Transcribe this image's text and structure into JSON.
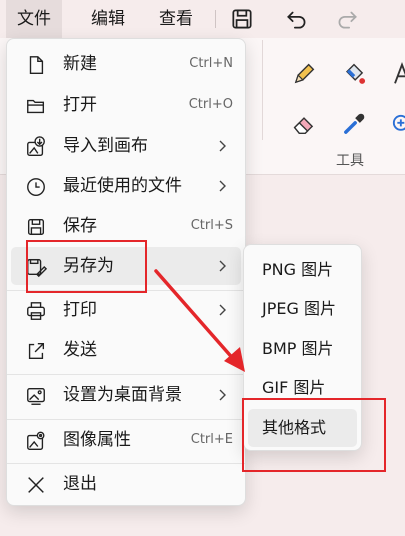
{
  "menubar": {
    "file": "文件",
    "edit": "编辑",
    "view": "查看",
    "quick_access": [
      "save-icon",
      "undo-icon",
      "redo-icon"
    ]
  },
  "ribbon": {
    "tools_label": "工具",
    "tools": [
      "pencil-icon",
      "fill-icon",
      "text-icon",
      "eraser-icon",
      "color-picker-icon",
      "zoom-icon"
    ]
  },
  "file_menu": {
    "items": [
      {
        "label": "新建",
        "shortcut": "Ctrl+N",
        "icon": "new-file-icon"
      },
      {
        "label": "打开",
        "shortcut": "Ctrl+O",
        "icon": "folder-open-icon"
      },
      {
        "label": "导入到画布",
        "shortcut": "",
        "icon": "import-image-icon",
        "submenu": true
      },
      {
        "label": "最近使用的文件",
        "shortcut": "",
        "icon": "clock-icon",
        "submenu": true
      },
      {
        "label": "保存",
        "shortcut": "Ctrl+S",
        "icon": "save-icon"
      },
      {
        "label": "另存为",
        "shortcut": "",
        "icon": "save-as-icon",
        "submenu": true,
        "active": true
      },
      {
        "label": "打印",
        "shortcut": "",
        "icon": "printer-icon",
        "submenu": true
      },
      {
        "label": "发送",
        "shortcut": "",
        "icon": "share-icon"
      },
      {
        "label": "设置为桌面背景",
        "shortcut": "",
        "icon": "wallpaper-icon",
        "submenu": true
      },
      {
        "label": "图像属性",
        "shortcut": "Ctrl+E",
        "icon": "image-properties-icon"
      },
      {
        "label": "退出",
        "shortcut": "",
        "icon": "close-icon"
      }
    ]
  },
  "save_as_submenu": {
    "items": [
      {
        "label": "PNG 图片"
      },
      {
        "label": "JPEG 图片"
      },
      {
        "label": "BMP 图片"
      },
      {
        "label": "GIF 图片"
      },
      {
        "label": "其他格式",
        "active": true
      }
    ]
  },
  "colors": {
    "annotation_red": "#e4262a",
    "hover_gray": "#ebebeb",
    "menu_bg": "#fafafa",
    "window_bg": "#f6ecec"
  }
}
